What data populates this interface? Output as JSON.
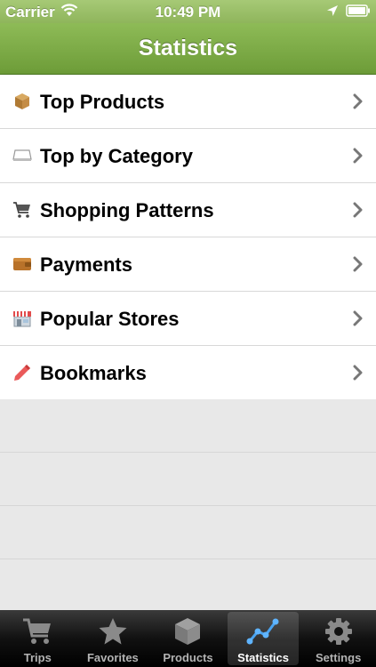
{
  "status_bar": {
    "carrier": "Carrier",
    "time": "10:49 PM",
    "icons": [
      "wifi-icon",
      "location-arrow-icon",
      "battery-icon"
    ]
  },
  "nav_bar": {
    "title": "Statistics"
  },
  "menu": {
    "items": [
      {
        "label": "Top Products",
        "icon": "box-icon"
      },
      {
        "label": "Top by Category",
        "icon": "shelf-icon"
      },
      {
        "label": "Shopping Patterns",
        "icon": "cart-icon"
      },
      {
        "label": "Payments",
        "icon": "wallet-icon"
      },
      {
        "label": "Popular Stores",
        "icon": "store-icon"
      },
      {
        "label": "Bookmarks",
        "icon": "bookmark-icon"
      }
    ]
  },
  "tab_bar": {
    "active": "Statistics",
    "tabs": [
      {
        "label": "Trips",
        "icon": "cart-icon"
      },
      {
        "label": "Favorites",
        "icon": "star-icon"
      },
      {
        "label": "Products",
        "icon": "box-icon"
      },
      {
        "label": "Statistics",
        "icon": "chart-icon"
      },
      {
        "label": "Settings",
        "icon": "gear-icon"
      }
    ]
  },
  "colors": {
    "nav_green": "#7aa845",
    "tab_background": "#111111"
  }
}
